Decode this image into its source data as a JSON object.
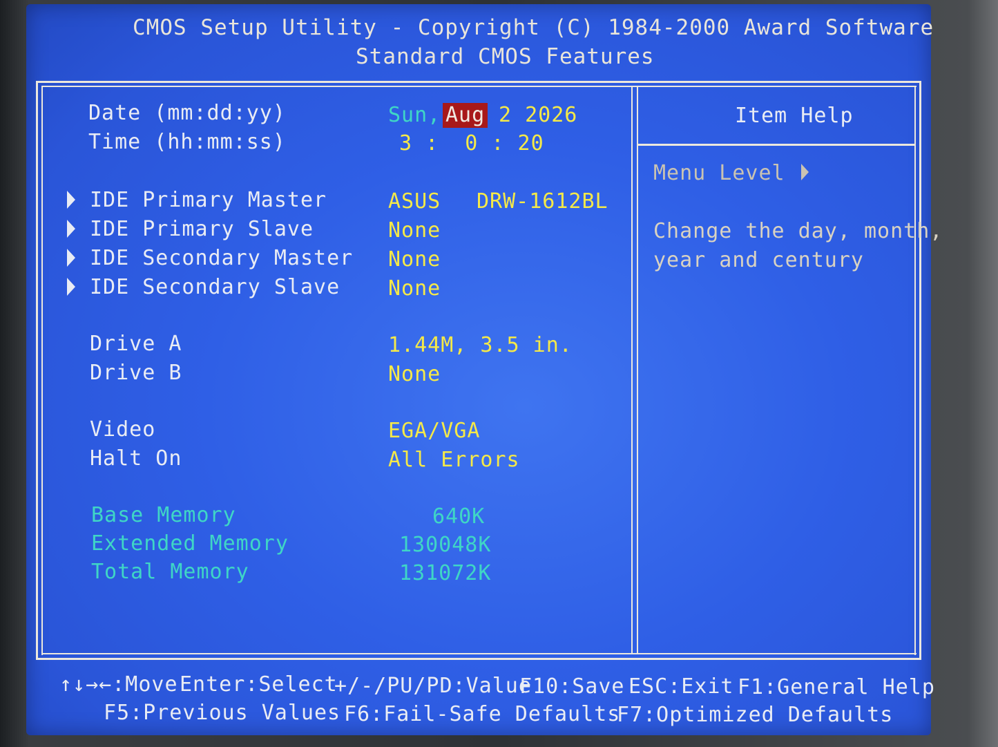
{
  "header": {
    "title": "CMOS Setup Utility - Copyright (C) 1984-2000 Award Software",
    "subtitle": "Standard CMOS Features"
  },
  "settings": {
    "date_label": "Date (mm:dd:yy)",
    "date_day": "Sun,",
    "date_month": "Aug",
    "date_rest": "2 2026",
    "time_label": "Time (hh:mm:ss)",
    "time_value": "3 :  0 : 20",
    "ide_primary_master_label": "IDE Primary Master",
    "ide_primary_master_vendor": "ASUS",
    "ide_primary_master_model": "DRW-1612BL",
    "ide_primary_slave_label": "IDE Primary Slave",
    "ide_primary_slave_value": "None",
    "ide_secondary_master_label": "IDE Secondary Master",
    "ide_secondary_master_value": "None",
    "ide_secondary_slave_label": "IDE Secondary Slave",
    "ide_secondary_slave_value": "None",
    "drive_a_label": "Drive A",
    "drive_a_value": "1.44M, 3.5 in.",
    "drive_b_label": "Drive B",
    "drive_b_value": "None",
    "video_label": "Video",
    "video_value": "EGA/VGA",
    "halt_on_label": "Halt On",
    "halt_on_value": "All Errors",
    "base_memory_label": "Base Memory",
    "base_memory_value": "640K",
    "extended_memory_label": "Extended Memory",
    "extended_memory_value": "130048K",
    "total_memory_label": "Total Memory",
    "total_memory_value": "131072K"
  },
  "help": {
    "title": "Item Help",
    "menu_level": "Menu Level",
    "text_line1": "Change the day, month,",
    "text_line2": "year and century"
  },
  "footer": {
    "move": "↑↓→←:Move",
    "select": "Enter:Select",
    "value": "+/-/PU/PD:Value",
    "save": "F10:Save",
    "exit": "ESC:Exit",
    "general_help": "F1:General Help",
    "previous_values": "F5:Previous Values",
    "fail_safe": "F6:Fail-Safe Defaults",
    "optimized": "F7:Optimized Defaults"
  },
  "colors": {
    "background": "#2f5fe6",
    "value_text": "#f5e948",
    "memory_text": "#3fd6c6",
    "highlight": "#a81919"
  }
}
